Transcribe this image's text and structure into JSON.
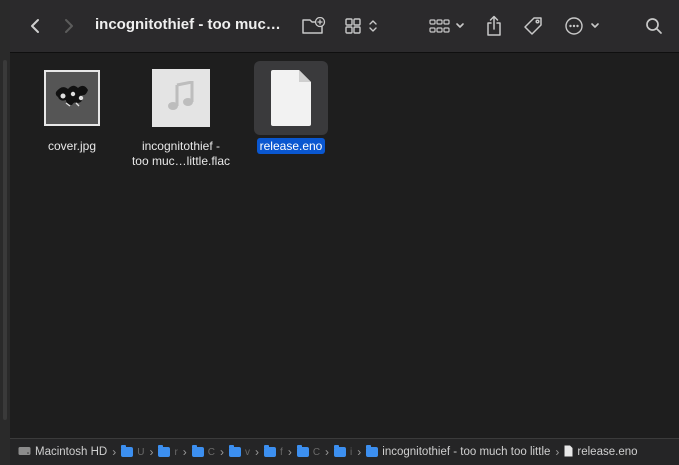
{
  "window": {
    "title": "incognitothief - too muc…"
  },
  "toolbar": {
    "back_icon": "chevron-left-icon",
    "forward_icon": "chevron-right-icon",
    "new_folder_icon": "new-folder-icon",
    "view_icon": "icon-grid-view-icon",
    "group_icon": "group-by-icon",
    "share_icon": "share-icon",
    "tag_icon": "tag-icon",
    "more_icon": "more-ellipsis-icon",
    "search_icon": "search-icon"
  },
  "files": [
    {
      "name": "cover.jpg",
      "line1": "cover.jpg",
      "line2": "",
      "type": "image",
      "selected": false
    },
    {
      "name": "incognitothief - too muc…little.flac",
      "line1": "incognitothief -",
      "line2": "too muc…little.flac",
      "type": "audio",
      "selected": false
    },
    {
      "name": "release.eno",
      "line1": "release.eno",
      "line2": "",
      "type": "document",
      "selected": true
    }
  ],
  "pathbar": {
    "root": "Macintosh HD",
    "collapsed": [
      "U",
      "r",
      "C",
      "v",
      "f",
      "C",
      "i"
    ],
    "parent": "incognitothief - too much too little",
    "current": "release.eno"
  },
  "colors": {
    "selection": "#0a57d0",
    "folder": "#3c8ff0",
    "toolbar_bg": "#2b2a2c",
    "content_bg": "#1e1e1e"
  }
}
